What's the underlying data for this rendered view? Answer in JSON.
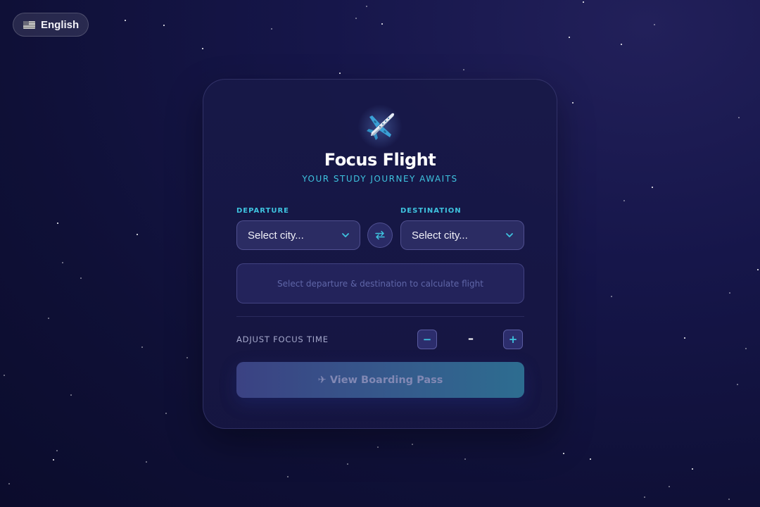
{
  "language_toggle": {
    "flag_icon": "us-flag-icon",
    "label": "English"
  },
  "card": {
    "icon": "airplane-icon",
    "title": "Focus Flight",
    "subtitle": "YOUR STUDY JOURNEY AWAITS",
    "departure": {
      "label": "DEPARTURE",
      "value": "Select city..."
    },
    "destination": {
      "label": "DESTINATION",
      "value": "Select city..."
    },
    "swap_icon": "swap-arrows-icon",
    "flight_info": "Select departure & destination to calculate flight",
    "focus_time": {
      "label": "ADJUST FOCUS TIME",
      "decrement": "−",
      "value": "–",
      "increment": "+"
    },
    "boarding_button": "✈ View Boarding Pass"
  },
  "colors": {
    "accent": "#3ec3df",
    "background": "#14154a",
    "card": "#18194a",
    "button_gradient_start": "#3b4283",
    "button_gradient_end": "#2d6d90"
  }
}
